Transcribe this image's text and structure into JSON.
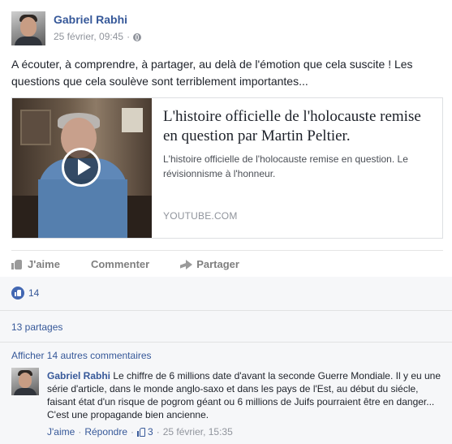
{
  "post": {
    "author": "Gabriel Rabhi",
    "timestamp": "25 février, 09:45",
    "separator": "·",
    "privacy_icon": "globe-icon",
    "text": "A écouter, à comprendre, à partager, au delà de l'émotion que cela suscite ! Les questions que cela soulève sont terriblement importantes...",
    "link": {
      "title": "L'histoire officielle de l'holocauste remise en question par Martin Peltier.",
      "description": "L'histoire officielle de l'holocauste remise en question. Le révisionnisme à l'honneur.",
      "domain": "YOUTUBE.COM"
    }
  },
  "actions": {
    "like_label": "J'aime",
    "comment_label": "Commenter",
    "share_label": "Partager"
  },
  "feedback": {
    "likes_count": "14",
    "shares_label": "13 partages",
    "more_comments_label": "Afficher 14 autres commentaires"
  },
  "comment": {
    "author": "Gabriel Rabhi",
    "text": "Le chiffre de 6 millions date d'avant la seconde Guerre Mondiale. Il y eu une série d'article, dans le monde anglo-saxo et dans les pays de l'Est, au début du siécle, faisant état d'un risque de pogrom géant ou 6 millions de Juifs pourraient être en danger... C'est une propagande bien ancienne.",
    "like_link": "J'aime",
    "reply_link": "Répondre",
    "dot": "·",
    "like_count": "3",
    "timestamp": "25 février, 15:35"
  },
  "colors": {
    "link_blue": "#365899",
    "like_badge": "#4267b2",
    "meta_grey": "#90949c",
    "feedback_bg": "#f6f7f9"
  }
}
